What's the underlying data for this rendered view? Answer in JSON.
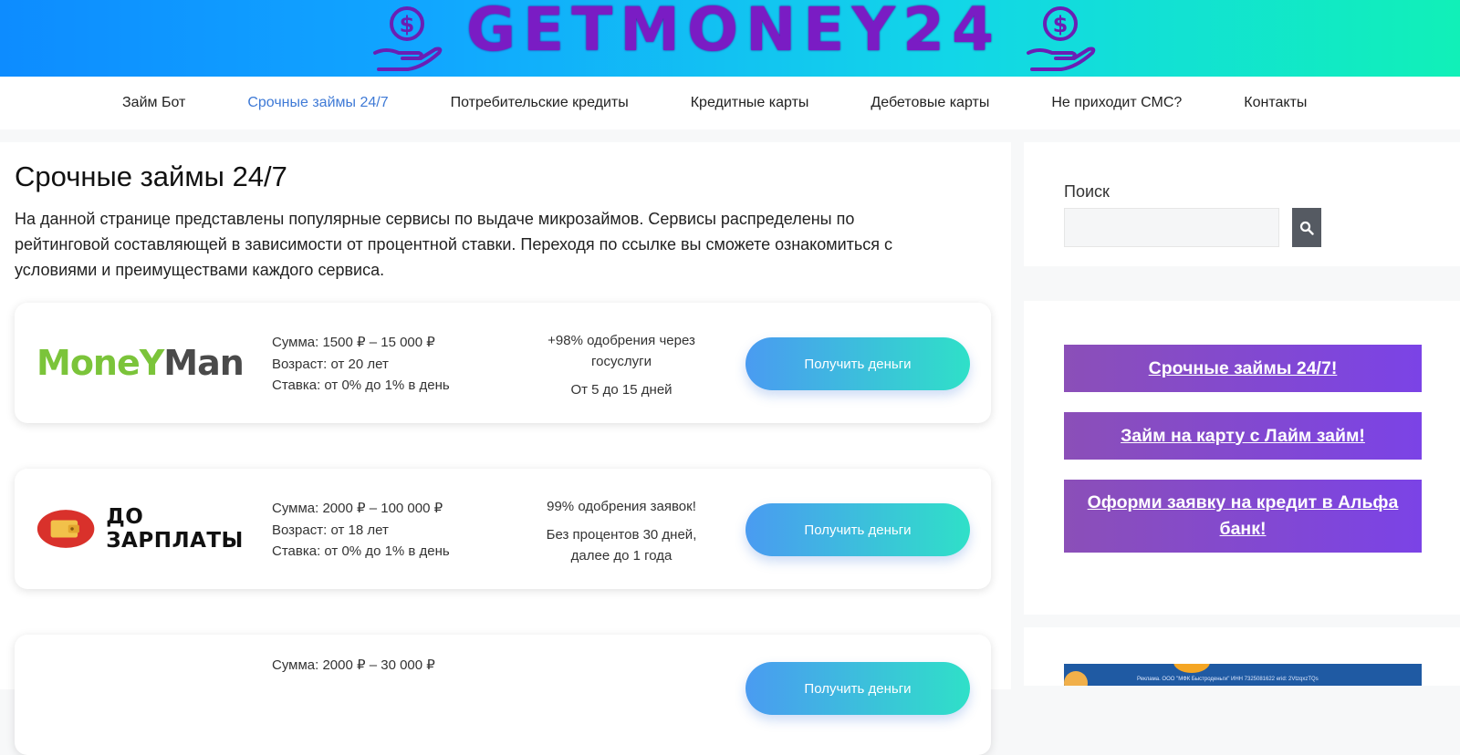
{
  "header": {
    "logo_text": "GETMONEY24",
    "colors": {
      "gradient_start": "#0d8cff",
      "gradient_end": "#11f0b8",
      "logo": "#7a1cc4"
    },
    "icons": [
      "money-hand-icon",
      "money-hand-icon"
    ]
  },
  "nav": {
    "items": [
      {
        "label": "Займ Бот"
      },
      {
        "label": "Срочные займы 24/7",
        "active": true
      },
      {
        "label": "Потребительские кредиты"
      },
      {
        "label": "Кредитные карты"
      },
      {
        "label": "Дебетовые карты"
      },
      {
        "label": "Не приходит СМС?"
      },
      {
        "label": "Контакты"
      }
    ]
  },
  "main": {
    "title": "Срочные займы 24/7",
    "intro": "На данной странице представлены популярные сервисы по выдаче микрозаймов. Сервисы распределены по рейтинговой составляющей в зависимости от процентной ставки. Переходя по ссылке вы сможете ознакомиться с условиями и преимуществами каждого сервиса.",
    "offers": [
      {
        "brand": "MoneyMan",
        "brand_part1": "MoneY",
        "brand_part2": "Man",
        "amount": "Сумма: 1500 ₽ – 15 000 ₽",
        "age": "Возраст: от 20 лет",
        "rate": "Ставка: от 0% до 1% в день",
        "promo": "+98% одобрения через госуслуги",
        "term": "От 5 до 15 дней",
        "button": "Получить деньги"
      },
      {
        "brand": "ДО ЗАРПЛАТЫ",
        "amount": "Сумма: 2000 ₽ – 100 000 ₽",
        "age": "Возраст: от 18 лет",
        "rate": "Ставка: от 0% до 1% в день",
        "promo": "99% одобрения заявок!",
        "term": "Без процентов 30 дней, далее до 1 года",
        "button": "Получить деньги"
      },
      {
        "amount": "Сумма: 2000 ₽ – 30 000 ₽",
        "button": "Получить деньги"
      }
    ],
    "button_gradient": [
      "#4a9bf1",
      "#2fe0c8"
    ]
  },
  "sidebar": {
    "search_label": "Поиск",
    "search_value": "",
    "search_icon": "search-icon",
    "links": [
      "Срочные займы 24/7!",
      "Займ на карту с Лайм займ!",
      "Оформи заявку на кредит в Альфа банк!"
    ],
    "link_gradient": [
      "#8b4fb8",
      "#7b43e6"
    ],
    "ad_text": "Реклама. ООО \"МФК Быстроденьги\" ИНН 7325081622 erid: 2VtzqxzTQs"
  }
}
